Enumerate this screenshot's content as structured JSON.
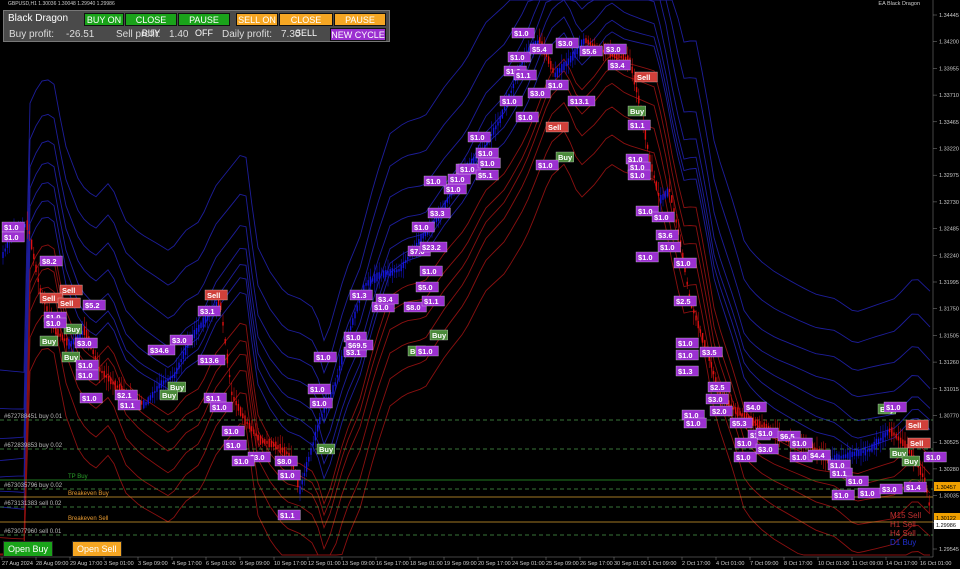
{
  "window": {
    "symbol_line": "GBPUSD,H1  1.30036 1.30048 1.29940 1.29986",
    "ea_name": "EA Black Dragon"
  },
  "panel": {
    "title": "Black Dragon",
    "buy_on": "BUY ON",
    "close_buy": "CLOSE BUY",
    "pause_off_buy": "PAUSE OFF",
    "sell_on": "SELL ON",
    "close_sell": "CLOSE SELL",
    "pause_off_sell": "PAUSE OFF",
    "buy_profit_label": "Buy profit:",
    "buy_profit_value": "-26.51",
    "sell_profit_label": "Sell profit:",
    "sell_profit_value": "1.40",
    "daily_profit_label": "Daily profit:",
    "daily_profit_value": "7.30",
    "new_cycle": "NEW CYCLE"
  },
  "bottom_buttons": {
    "open_buy": "Open Buy",
    "open_sell": "Open Sell"
  },
  "order_lines": [
    {
      "label": "#672788451 buy 0.01"
    },
    {
      "label": "#672839853 buy 0.02"
    },
    {
      "label": "TP Buy"
    },
    {
      "label": "#673035796 buy 0.02"
    },
    {
      "label": "Breakeven Buy"
    },
    {
      "label": "#673131383 sell 0.02"
    },
    {
      "label": "Breakeven Sell"
    },
    {
      "label": "#673077960 sell 0.01"
    }
  ],
  "right_labels": [
    "M15 Sell",
    "H1 Sell",
    "H4 Sell",
    "D1 Buy"
  ],
  "price_axis": [
    "1.34445",
    "1.34200",
    "1.33955",
    "1.33710",
    "1.33465",
    "1.33220",
    "1.32975",
    "1.32730",
    "1.32485",
    "1.32240",
    "1.31995",
    "1.31750",
    "1.31505",
    "1.31260",
    "1.31015",
    "1.30770",
    "1.30525",
    "1.30280",
    "1.30035",
    "1.29790",
    "1.29545"
  ],
  "time_axis": [
    "27 Aug 2024",
    "28 Aug 09:00",
    "29 Aug 17:00",
    "3 Sep 01:00",
    "3 Sep 09:00",
    "4 Sep 17:00",
    "6 Sep 01:00",
    "9 Sep 09:00",
    "10 Sep 17:00",
    "12 Sep 01:00",
    "13 Sep 09:00",
    "16 Sep 17:00",
    "18 Sep 01:00",
    "19 Sep 09:00",
    "20 Sep 17:00",
    "24 Sep 01:00",
    "25 Sep 09:00",
    "26 Sep 17:00",
    "30 Sep 01:00",
    "1 Oct 09:00",
    "2 Oct 17:00",
    "4 Oct 01:00",
    "7 Oct 09:00",
    "8 Oct 17:00",
    "10 Oct 01:00",
    "11 Oct 09:00",
    "14 Oct 17:00",
    "16 Oct 01:00"
  ],
  "price_tags": [
    "1.30457",
    "1.30122",
    "1.29986"
  ],
  "trade_labels": [
    {
      "t": "$1.0",
      "k": "p"
    },
    {
      "t": "$1.0",
      "k": "p"
    },
    {
      "t": "$8.2",
      "k": "p"
    },
    {
      "t": "Sell",
      "k": "s"
    },
    {
      "t": "Sell",
      "k": "s"
    },
    {
      "t": "$5.2",
      "k": "p"
    },
    {
      "t": "$1.0",
      "k": "p"
    },
    {
      "t": "Sell",
      "k": "s"
    },
    {
      "t": "Buy",
      "k": "b"
    },
    {
      "t": "Buy",
      "k": "b"
    },
    {
      "t": "$3.0",
      "k": "p"
    },
    {
      "t": "Buy",
      "k": "b"
    },
    {
      "t": "$1.0",
      "k": "p"
    },
    {
      "t": "$1.0",
      "k": "p"
    },
    {
      "t": "$1.0",
      "k": "p"
    },
    {
      "t": "$3.0",
      "k": "p"
    },
    {
      "t": "$34.6",
      "k": "p"
    },
    {
      "t": "$13.6",
      "k": "p"
    },
    {
      "t": "$3.1",
      "k": "p"
    },
    {
      "t": "Sell",
      "k": "s"
    },
    {
      "t": "$2.1",
      "k": "p"
    },
    {
      "t": "Buy",
      "k": "b"
    },
    {
      "t": "Buy",
      "k": "b"
    },
    {
      "t": "$1.0",
      "k": "p"
    },
    {
      "t": "$1.1",
      "k": "p"
    },
    {
      "t": "$1.1",
      "k": "p"
    },
    {
      "t": "$1.0",
      "k": "p"
    },
    {
      "t": "$1.0",
      "k": "p"
    },
    {
      "t": "$3.0",
      "k": "p"
    },
    {
      "t": "$8.0",
      "k": "p"
    },
    {
      "t": "$1.0",
      "k": "p"
    },
    {
      "t": "$1.1",
      "k": "p"
    },
    {
      "t": "Buy",
      "k": "b"
    },
    {
      "t": "$1.0",
      "k": "p"
    },
    {
      "t": "$1.0",
      "k": "p"
    },
    {
      "t": "$1.0",
      "k": "p"
    },
    {
      "t": "$1.0",
      "k": "p"
    },
    {
      "t": "$1.0",
      "k": "p"
    },
    {
      "t": "$3.1",
      "k": "p"
    },
    {
      "t": "$1.0",
      "k": "p"
    },
    {
      "t": "$1.0",
      "k": "p"
    },
    {
      "t": "$1.3",
      "k": "p"
    },
    {
      "t": "$3.4",
      "k": "p"
    },
    {
      "t": "$69.5",
      "k": "p"
    },
    {
      "t": "Buy",
      "k": "b"
    },
    {
      "t": "$1.0",
      "k": "p"
    },
    {
      "t": "Buy",
      "k": "b"
    },
    {
      "t": "$8.0",
      "k": "p"
    },
    {
      "t": "$5.0",
      "k": "p"
    },
    {
      "t": "$1.0",
      "k": "p"
    },
    {
      "t": "$1.1",
      "k": "p"
    },
    {
      "t": "$7.0",
      "k": "p"
    },
    {
      "t": "$3.3",
      "k": "p"
    },
    {
      "t": "$23.2",
      "k": "p"
    },
    {
      "t": "$1.0",
      "k": "p"
    },
    {
      "t": "$1.0",
      "k": "p"
    },
    {
      "t": "$3.0",
      "k": "p"
    },
    {
      "t": "$1.0",
      "k": "p"
    },
    {
      "t": "$1.0",
      "k": "p"
    },
    {
      "t": "$1.0",
      "k": "p"
    },
    {
      "t": "$1.0",
      "k": "p"
    },
    {
      "t": "$1.0",
      "k": "p"
    },
    {
      "t": "$5.1",
      "k": "p"
    },
    {
      "t": "$1.0",
      "k": "p"
    },
    {
      "t": "$1.0",
      "k": "p"
    },
    {
      "t": "$1.0",
      "k": "p"
    },
    {
      "t": "$1.0",
      "k": "p"
    },
    {
      "t": "Sell",
      "k": "s"
    },
    {
      "t": "Buy",
      "k": "b"
    },
    {
      "t": "$1.0",
      "k": "p"
    },
    {
      "t": "$1.0",
      "k": "p"
    },
    {
      "t": "$5.4",
      "k": "p"
    },
    {
      "t": "$1.0",
      "k": "p"
    },
    {
      "t": "$1.1",
      "k": "p"
    },
    {
      "t": "$1.0",
      "k": "p"
    },
    {
      "t": "$3.0",
      "k": "p"
    },
    {
      "t": "$13.1",
      "k": "p"
    },
    {
      "t": "$5.6",
      "k": "p"
    },
    {
      "t": "$3.0",
      "k": "p"
    },
    {
      "t": "$3.0",
      "k": "p"
    },
    {
      "t": "$3.4",
      "k": "p"
    },
    {
      "t": "Sell",
      "k": "s"
    },
    {
      "t": "Buy",
      "k": "b"
    },
    {
      "t": "$1.1",
      "k": "p"
    },
    {
      "t": "$1.0",
      "k": "p"
    },
    {
      "t": "$1.0",
      "k": "p"
    },
    {
      "t": "$1.0",
      "k": "p"
    },
    {
      "t": "$1.0",
      "k": "p"
    },
    {
      "t": "$1.0",
      "k": "p"
    },
    {
      "t": "$3.6",
      "k": "p"
    },
    {
      "t": "$1.0",
      "k": "p"
    },
    {
      "t": "$1.0",
      "k": "p"
    },
    {
      "t": "$1.0",
      "k": "p"
    },
    {
      "t": "$2.5",
      "k": "p"
    },
    {
      "t": "$1.0",
      "k": "p"
    },
    {
      "t": "$1.0",
      "k": "p"
    },
    {
      "t": "$3.5",
      "k": "p"
    },
    {
      "t": "$1.3",
      "k": "p"
    },
    {
      "t": "$2.5",
      "k": "p"
    },
    {
      "t": "$2.0",
      "k": "p"
    },
    {
      "t": "$1.0",
      "k": "p"
    },
    {
      "t": "$1.0",
      "k": "p"
    },
    {
      "t": "$5.3",
      "k": "p"
    },
    {
      "t": "$4.0",
      "k": "p"
    },
    {
      "t": "$3.0",
      "k": "p"
    },
    {
      "t": "$1.0",
      "k": "p"
    },
    {
      "t": "$1.0",
      "k": "p"
    },
    {
      "t": "$1.0",
      "k": "p"
    },
    {
      "t": "$6.5",
      "k": "p"
    },
    {
      "t": "$1.0",
      "k": "p"
    },
    {
      "t": "$3.0",
      "k": "p"
    },
    {
      "t": "$1.0",
      "k": "p"
    },
    {
      "t": "$1.0",
      "k": "p"
    },
    {
      "t": "$4.4",
      "k": "p"
    },
    {
      "t": "$1.0",
      "k": "p"
    },
    {
      "t": "$1.1",
      "k": "p"
    },
    {
      "t": "$1.0",
      "k": "p"
    },
    {
      "t": "$1.0",
      "k": "p"
    },
    {
      "t": "$1.0",
      "k": "p"
    },
    {
      "t": "$3.0",
      "k": "p"
    },
    {
      "t": "Buy",
      "k": "b"
    },
    {
      "t": "$1.4",
      "k": "p"
    },
    {
      "t": "$1.0",
      "k": "p"
    },
    {
      "t": "Sell",
      "k": "s"
    },
    {
      "t": "Sell",
      "k": "s"
    },
    {
      "t": "Buy",
      "k": "b"
    },
    {
      "t": "Buy",
      "k": "b"
    },
    {
      "t": "$1.0",
      "k": "p"
    }
  ],
  "colors": {
    "background": "#000000",
    "candle_up": "#1515e0",
    "candle_down": "#e01010",
    "band_blue": "#1d1d9a",
    "band_red": "#8a1010",
    "label_purple": "#9b30d0",
    "label_sell": "#d0403a",
    "label_buy": "#4a8a3a"
  }
}
